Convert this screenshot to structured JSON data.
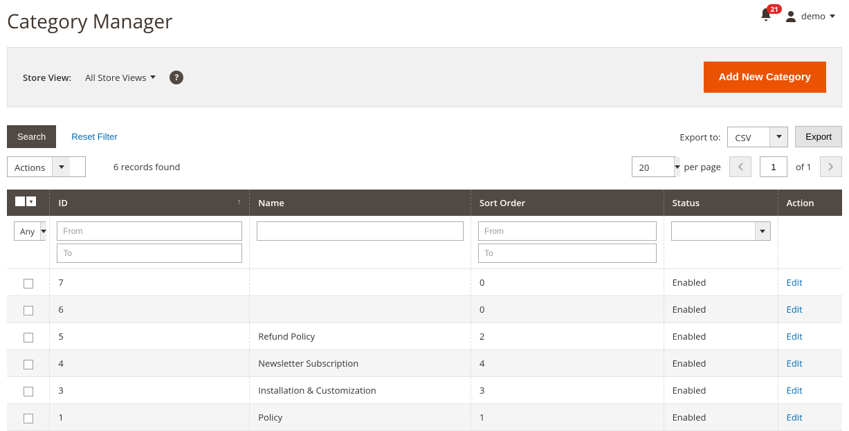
{
  "page": {
    "title": "Category Manager"
  },
  "user": {
    "notifications": "21",
    "name": "demo"
  },
  "store": {
    "label": "Store View:",
    "value": "All Store Views"
  },
  "buttons": {
    "add": "Add New Category",
    "search": "Search",
    "reset": "Reset Filter",
    "export": "Export"
  },
  "export": {
    "label": "Export to:",
    "value": "CSV"
  },
  "actions": {
    "label": "Actions"
  },
  "records": {
    "text": "6 records found"
  },
  "pager": {
    "per_page": "20",
    "per_page_label": "per page",
    "page": "1",
    "of_label": "of 1"
  },
  "columns": {
    "id": "ID",
    "name": "Name",
    "sort": "Sort Order",
    "status": "Status",
    "action": "Action"
  },
  "filters": {
    "any": "Any",
    "from": "From",
    "to": "To"
  },
  "rows": [
    {
      "id": "7",
      "name": "",
      "sort": "0",
      "status": "Enabled",
      "action": "Edit"
    },
    {
      "id": "6",
      "name": "",
      "sort": "0",
      "status": "Enabled",
      "action": "Edit"
    },
    {
      "id": "5",
      "name": "Refund Policy",
      "sort": "2",
      "status": "Enabled",
      "action": "Edit"
    },
    {
      "id": "4",
      "name": "Newsletter Subscription",
      "sort": "4",
      "status": "Enabled",
      "action": "Edit"
    },
    {
      "id": "3",
      "name": "Installation & Customization",
      "sort": "3",
      "status": "Enabled",
      "action": "Edit"
    },
    {
      "id": "1",
      "name": "Policy",
      "sort": "1",
      "status": "Enabled",
      "action": "Edit"
    }
  ]
}
